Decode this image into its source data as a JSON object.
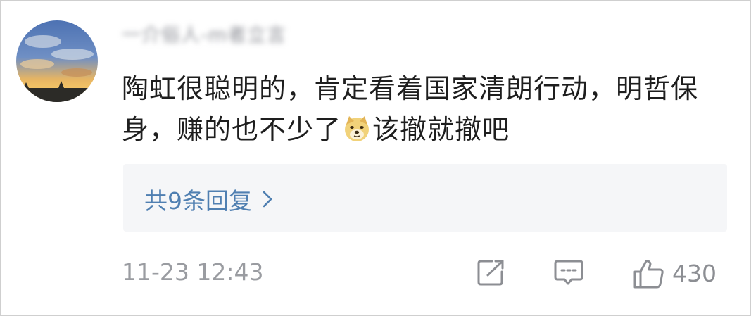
{
  "comment": {
    "username": "一介俗人-m者立言",
    "text_part1": "陶虹很聪明的，肯定看着国家清朗行动，明哲保身，赚的也不少了",
    "emoji": "doge-emoji",
    "text_part2": "该撤就撤吧",
    "replies_label": "共9条回复",
    "timestamp": "11-23 12:43",
    "like_count": "430"
  },
  "icons": [
    "doge-emoji",
    "chevron-right-icon",
    "share-icon",
    "comment-icon",
    "thumbs-up-icon"
  ],
  "colors": {
    "link": "#4f7fb1",
    "meta": "#9a9ca1",
    "reply_bg": "#f5f6f8",
    "text": "#1e1e1e"
  }
}
